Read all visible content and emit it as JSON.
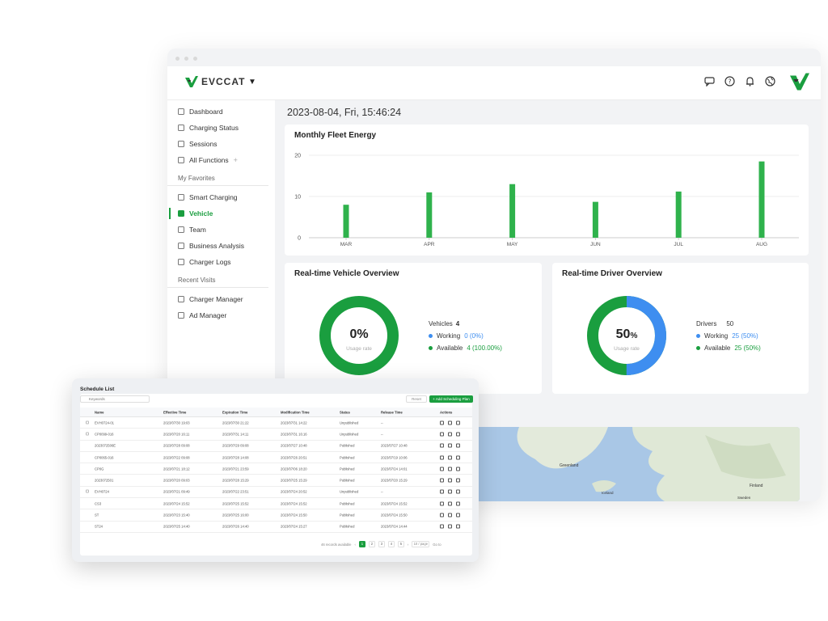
{
  "brand": {
    "name": "EVCCAT",
    "accent": "#1a9e3f",
    "blue": "#3e8ef0"
  },
  "header": {
    "icons": [
      "chat-icon",
      "help-icon",
      "bell-icon",
      "globe-icon"
    ]
  },
  "sidebar": {
    "main": [
      {
        "label": "Dashboard",
        "icon": "dashboard-icon"
      },
      {
        "label": "Charging Status",
        "icon": "charging-status-icon"
      },
      {
        "label": "Sessions",
        "icon": "sessions-icon"
      },
      {
        "label": "All Functions",
        "icon": "all-functions-icon",
        "plus": "+"
      }
    ],
    "favorites_label": "My Favorites",
    "favorites": [
      {
        "label": "Smart Charging",
        "icon": "smart-charging-icon"
      },
      {
        "label": "Vehicle",
        "icon": "vehicle-icon",
        "active": true
      },
      {
        "label": "Team",
        "icon": "team-icon"
      },
      {
        "label": "Business Analysis",
        "icon": "business-analysis-icon"
      },
      {
        "label": "Charger Logs",
        "icon": "charger-logs-icon"
      }
    ],
    "recent_label": "Recent Visits",
    "recent": [
      {
        "label": "Charger Manager",
        "icon": "charger-manager-icon"
      },
      {
        "label": "Ad Manager",
        "icon": "ad-manager-icon"
      }
    ]
  },
  "datetime": "2023-08-04, Fri, 15:46:24",
  "energy": {
    "title": "Monthly Fleet Energy"
  },
  "chart_data": {
    "type": "bar",
    "categories": [
      "MAR",
      "APR",
      "MAY",
      "JUN",
      "JUL",
      "AUG"
    ],
    "values": [
      8,
      11,
      13,
      8.7,
      11.2,
      18.5
    ],
    "ylim": [
      0,
      20
    ],
    "yticks": [
      0,
      10,
      20
    ],
    "grid": true,
    "color": "#2fb24c"
  },
  "vehicle": {
    "title": "Real-time Vehicle Overview",
    "percent": "0%",
    "usage_label": "Usage rate",
    "usage_fraction": 0,
    "total_label": "Vehicles",
    "total": "4",
    "working_label": "Working",
    "working_value": "0 (0%)",
    "available_label": "Available",
    "available_value": "4 (100.00%)"
  },
  "driver": {
    "title": "Real-time Driver Overview",
    "percent_num": "50",
    "percent_sign": "%",
    "usage_label": "Usage rate",
    "usage_fraction": 0.5,
    "total_label": "Drivers",
    "total": "50",
    "working_label": "Working",
    "working_value": "25 (50%)",
    "available_label": "Available",
    "available_value": "25 (50%)"
  },
  "map": {
    "labels": [
      "Greenland",
      "Finland",
      "Iceland",
      "Sweden"
    ]
  },
  "schedule": {
    "title": "Schedule List",
    "search_placeholder": "Keywords",
    "reset_label": "Reset",
    "add_label": "+ Add Scheduling Plan",
    "columns": [
      "Name",
      "Effective Time",
      "Expiration Time",
      "Modification Time",
      "Status",
      "Release Time",
      "Actions"
    ],
    "rows": [
      {
        "check": true,
        "name": "EVH0724-01",
        "eff": "2023/07/30 19:03",
        "exp": "2023/07/30 21:22",
        "mod": "2023/07/31 14:22",
        "status": "Unpublished",
        "rel": "--"
      },
      {
        "check": true,
        "name": "CP0099-016",
        "eff": "2023/07/20 16:11",
        "exp": "2023/07/31 14:11",
        "mod": "2023/07/31 16:16",
        "status": "Unpublished",
        "rel": "--"
      },
      {
        "check": false,
        "name": "2023072506E",
        "eff": "2023/07/28 09:08",
        "exp": "2023/07/29 09:08",
        "mod": "2023/07/27 10:48",
        "status": "Published",
        "rel": "2023/07/27 10:48"
      },
      {
        "check": false,
        "name": "CP0065-016",
        "eff": "2023/07/22 09:08",
        "exp": "2023/07/28 14:08",
        "mod": "2023/07/26 20:51",
        "status": "Published",
        "rel": "2023/07/19 10:06"
      },
      {
        "check": false,
        "name": "CP0G",
        "eff": "2023/07/21 18:12",
        "exp": "2023/07/21 23:59",
        "mod": "2023/07/06 18:20",
        "status": "Published",
        "rel": "2023/07/24 14:01"
      },
      {
        "check": false,
        "name": "2023072501",
        "eff": "2023/07/20 09:03",
        "exp": "2023/07/28 15:29",
        "mod": "2023/07/25 15:29",
        "status": "Published",
        "rel": "2023/07/20 15:29"
      },
      {
        "check": true,
        "name": "EVH0724",
        "eff": "2023/07/21 09:49",
        "exp": "2023/07/22 23:51",
        "mod": "2023/07/24 20:52",
        "status": "Unpublished",
        "rel": "--"
      },
      {
        "check": false,
        "name": "CS3",
        "eff": "2023/07/24 15:52",
        "exp": "2023/07/25 15:52",
        "mod": "2023/07/24 15:52",
        "status": "Published",
        "rel": "2023/07/24 15:52"
      },
      {
        "check": false,
        "name": "ST",
        "eff": "2023/07/23 15:40",
        "exp": "2023/07/25 16:00",
        "mod": "2023/07/24 15:50",
        "status": "Published",
        "rel": "2023/07/24 15:50"
      },
      {
        "check": false,
        "name": "ST24",
        "eff": "2023/07/25 14:40",
        "exp": "2023/07/26 14:40",
        "mod": "2023/07/24 15:27",
        "status": "Published",
        "rel": "2023/07/24 14:44"
      }
    ],
    "pager": {
      "total_text": "46 records available",
      "prev": "‹",
      "pages": [
        "1",
        "2",
        "3",
        "4",
        "5"
      ],
      "next": "›",
      "page_size": "10 / page",
      "goto": "Go to"
    }
  }
}
